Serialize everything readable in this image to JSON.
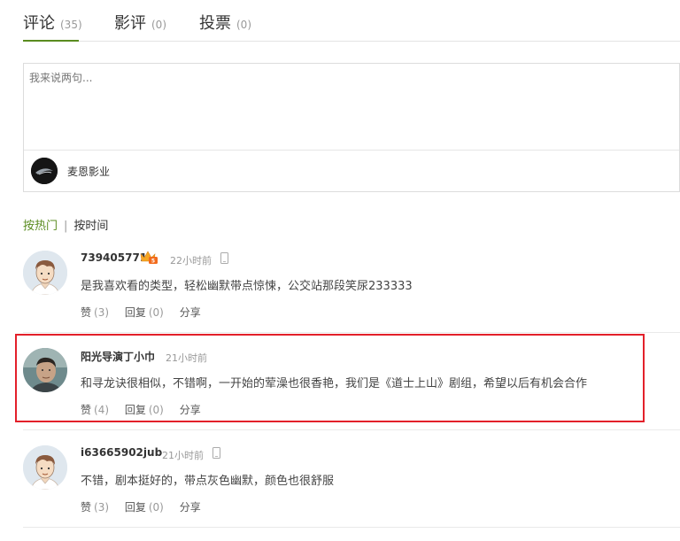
{
  "tabs": [
    {
      "label": "评论",
      "count": "(35)"
    },
    {
      "label": "影评",
      "count": "(0)"
    },
    {
      "label": "投票",
      "count": "(0)"
    }
  ],
  "comment_box": {
    "placeholder": "我来说两句...",
    "user_name": "麦恩影业"
  },
  "sort": {
    "hot": "按热门",
    "separator": "|",
    "time": "按时间"
  },
  "comments": [
    {
      "user": "739405771",
      "time": "22小时前",
      "text": "是我喜欢看的类型，轻松幽默带点惊悚，公交站那段笑尿233333",
      "like": "赞",
      "like_count": "(3)",
      "reply": "回复",
      "reply_count": "(0)",
      "share": "分享"
    },
    {
      "user": "阳光导演丁小巾",
      "time": "21小时前",
      "text": "和寻龙诀很相似，不错啊，一开始的荤澡也很香艳，我们是《道士上山》剧组，希望以后有机会合作",
      "like": "赞",
      "like_count": "(4)",
      "reply": "回复",
      "reply_count": "(0)",
      "share": "分享"
    },
    {
      "user": "i63665902jub",
      "time": "21小时前",
      "text": "不错，剧本挺好的，带点灰色幽默，颜色也很舒服",
      "like": "赞",
      "like_count": "(3)",
      "reply": "回复",
      "reply_count": "(0)",
      "share": "分享"
    }
  ],
  "colors": {
    "accent_green": "#5a8c20",
    "highlight_red": "#e3202a",
    "muted_gray": "#999999"
  },
  "icons": {
    "vip_badge": "crown-badge-icon",
    "device": "mobile-phone-icon"
  }
}
